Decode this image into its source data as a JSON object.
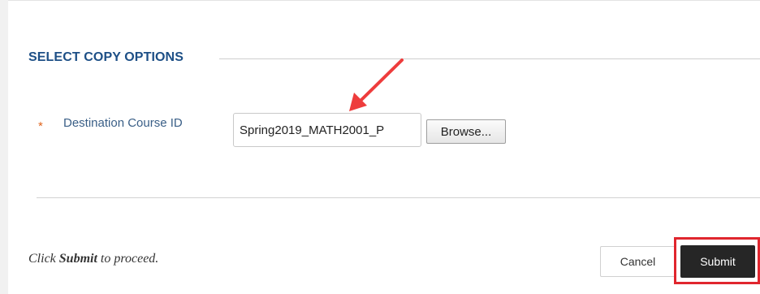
{
  "section": {
    "title": "SELECT COPY OPTIONS"
  },
  "destination": {
    "required_marker": "*",
    "label": "Destination Course ID",
    "value": "Spring2019_MATH2001_P",
    "browse_label": "Browse..."
  },
  "footer": {
    "instruction_prefix": "Click ",
    "instruction_bold": "Submit",
    "instruction_suffix": " to proceed.",
    "cancel_label": "Cancel",
    "submit_label": "Submit"
  },
  "colors": {
    "section_title": "#1d4f86",
    "required": "#e0661f",
    "annotation": "#ee3c3c",
    "submit_bg": "#262626"
  },
  "icons": {
    "annotation_arrow": "red-arrow-icon"
  }
}
